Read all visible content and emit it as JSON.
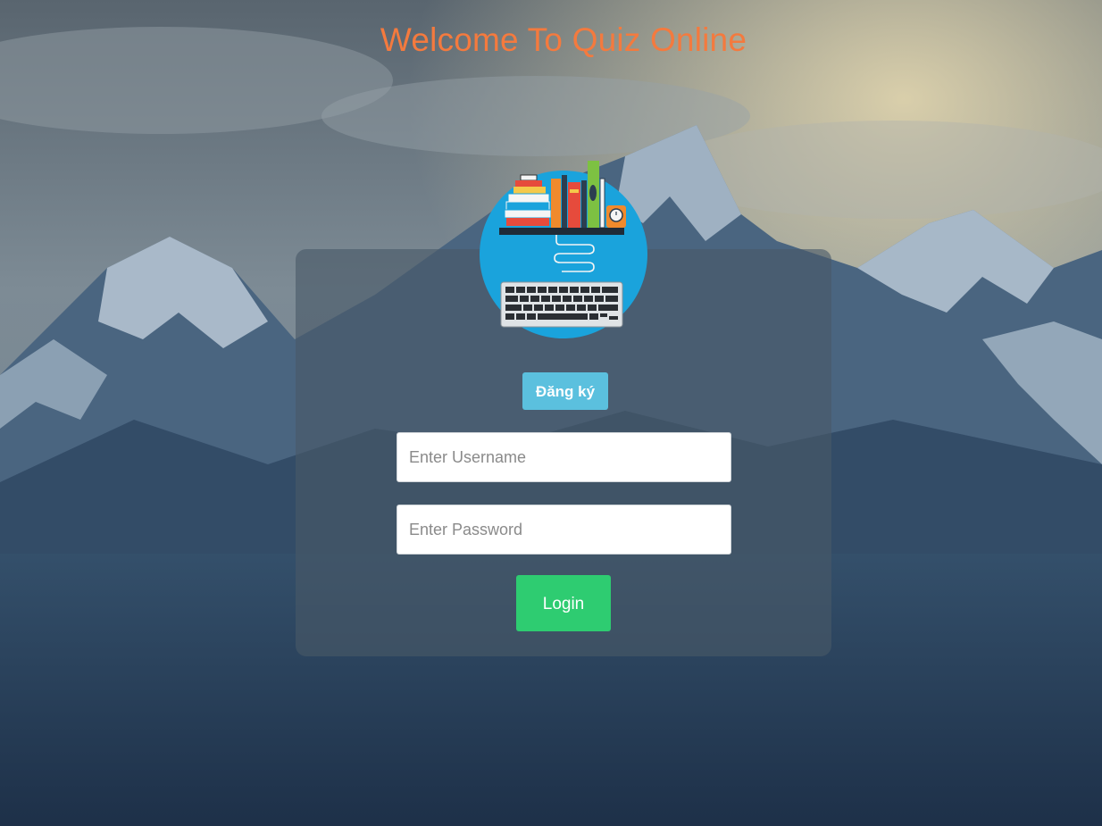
{
  "header": {
    "title": "Welcome To Quiz Online"
  },
  "logo": {
    "icon": "bookshelf-keyboard-icon",
    "accent": "#1aa3dc"
  },
  "form": {
    "register_label": "Đăng ký",
    "username_placeholder": "Enter Username",
    "password_placeholder": "Enter Password",
    "login_label": "Login"
  },
  "colors": {
    "title": "#f47a3e",
    "register_button": "#5bc0de",
    "login_button": "#2ecc71"
  }
}
